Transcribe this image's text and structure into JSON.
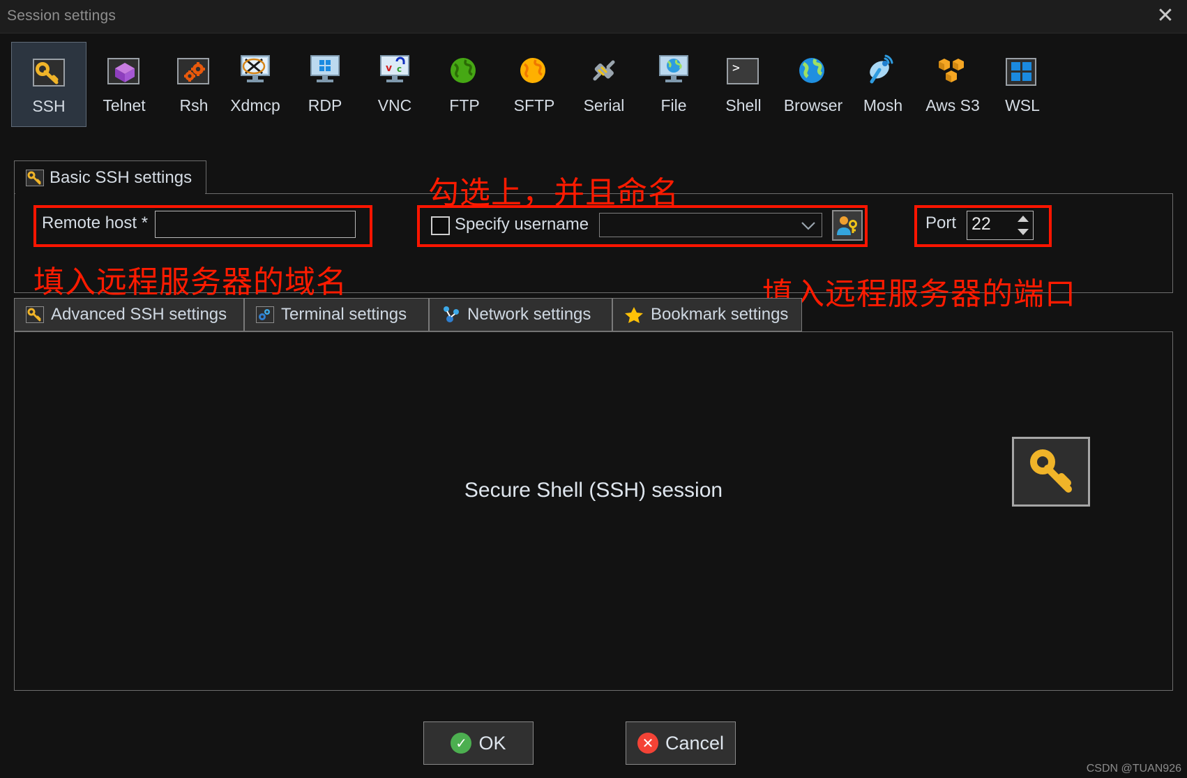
{
  "window": {
    "title": "Session settings",
    "close_label": "✕"
  },
  "session_types": [
    {
      "label": "SSH",
      "icon": "key-icon",
      "selected": true
    },
    {
      "label": "Telnet",
      "icon": "purple-cube-icon",
      "selected": false
    },
    {
      "label": "Rsh",
      "icon": "orange-gears-icon",
      "selected": false
    },
    {
      "label": "Xdmcp",
      "icon": "x-monitor-icon",
      "selected": false
    },
    {
      "label": "RDP",
      "icon": "windows-monitor-icon",
      "selected": false
    },
    {
      "label": "VNC",
      "icon": "vnc-monitor-icon",
      "selected": false
    },
    {
      "label": "FTP",
      "icon": "green-globe-icon",
      "selected": false
    },
    {
      "label": "SFTP",
      "icon": "orange-globe-icon",
      "selected": false
    },
    {
      "label": "Serial",
      "icon": "plug-icon",
      "selected": false
    },
    {
      "label": "File",
      "icon": "globe-monitor-icon",
      "selected": false
    },
    {
      "label": "Shell",
      "icon": "terminal-icon",
      "selected": false
    },
    {
      "label": "Browser",
      "icon": "blue-globe-icon",
      "selected": false
    },
    {
      "label": "Mosh",
      "icon": "satellite-dish-icon",
      "selected": false
    },
    {
      "label": "Aws S3",
      "icon": "aws-cubes-icon",
      "selected": false
    },
    {
      "label": "WSL",
      "icon": "windows-icon",
      "selected": false
    }
  ],
  "basic_tab": {
    "label": "Basic SSH settings",
    "icon": "key-icon"
  },
  "fields": {
    "remote_host_label": "Remote host *",
    "remote_host_value": "",
    "specify_username_label": "Specify username",
    "specify_username_checked": false,
    "username_value": "",
    "username_picker_icon": "user-key-icon",
    "port_label": "Port",
    "port_value": "22"
  },
  "annotations": {
    "username_note": "勾选上，并且命名",
    "host_note": "填入远程服务器的域名",
    "port_note": "填入远程服务器的端口",
    "color": "#ff1b00"
  },
  "sub_tabs": [
    {
      "label": "Advanced SSH settings",
      "icon": "key-icon"
    },
    {
      "label": "Terminal settings",
      "icon": "blue-gears-icon"
    },
    {
      "label": "Network settings",
      "icon": "network-nodes-icon"
    },
    {
      "label": "Bookmark settings",
      "icon": "star-icon"
    }
  ],
  "content": {
    "caption": "Secure Shell (SSH) session",
    "icon": "key-icon"
  },
  "footer": {
    "ok_label": "OK",
    "ok_icon": "check-circle-icon",
    "cancel_label": "Cancel",
    "cancel_icon": "x-circle-icon"
  },
  "watermark": "CSDN @TUAN926"
}
